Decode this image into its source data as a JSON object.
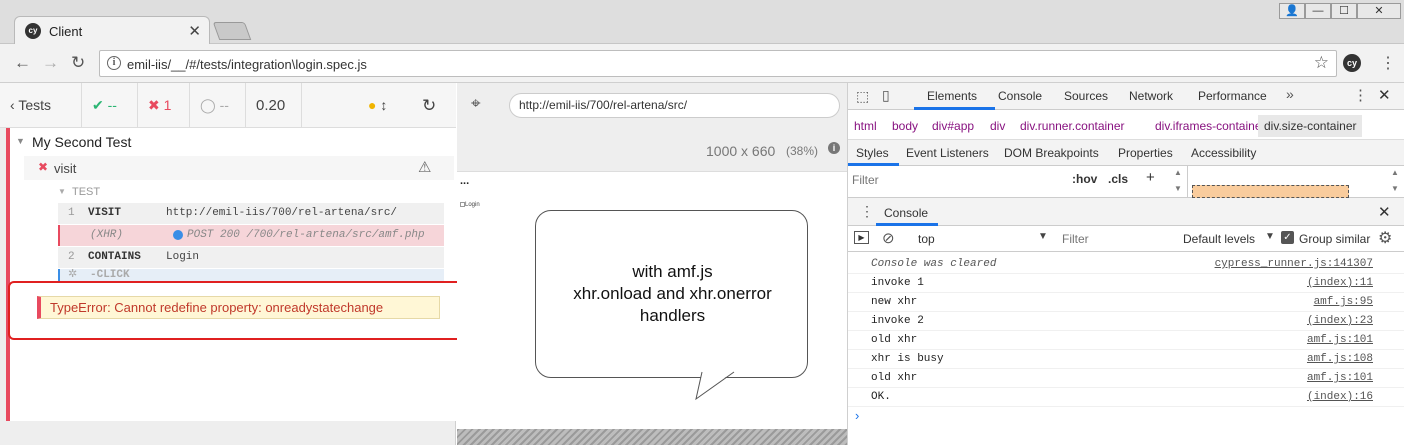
{
  "browser": {
    "tab_title": "Client",
    "url": "emil-iis/__/#/tests/integration\\login.spec.js"
  },
  "reporter": {
    "tests_label": "Tests",
    "passed": "--",
    "failed": "1",
    "pending": "--",
    "duration": "0.20",
    "suite": "My Second Test",
    "test": "visit",
    "section": "TEST",
    "commands": [
      {
        "num": "1",
        "name": "VISIT",
        "message": "http://emil-iis/700/rel-artena/src/"
      },
      {
        "num": "",
        "name": "(XHR)",
        "message": "POST 200 /700/rel-artena/src/amf.php"
      },
      {
        "num": "2",
        "name": "CONTAINS",
        "message": "Login"
      },
      {
        "num": "",
        "name": "-CLICK",
        "message": ""
      }
    ],
    "error": "TypeError: Cannot redefine property: onreadystatechange"
  },
  "aut": {
    "url": "http://emil-iis/700/rel-artena/src/",
    "viewport": "1000 x 660",
    "scale": "(38%)",
    "page_ellipsis": "...",
    "page_login": "Login"
  },
  "annotation": {
    "line1": "with amf.js",
    "line2": "xhr.onload and xhr.onerror",
    "line3": "handlers"
  },
  "devtools": {
    "tabs": [
      "Elements",
      "Console",
      "Sources",
      "Network",
      "Performance"
    ],
    "breadcrumbs": [
      "html",
      "body",
      "div#app",
      "div",
      "div.runner.container",
      "div.iframes-container",
      "div.size-container"
    ],
    "subtabs": [
      "Styles",
      "Event Listeners",
      "DOM Breakpoints",
      "Properties",
      "Accessibility"
    ],
    "filter_placeholder": "Filter",
    "hov": ":hov",
    "cls": ".cls",
    "drawer_title": "Console",
    "context": "top",
    "console_filter_placeholder": "Filter",
    "levels": "Default levels",
    "group_similar": "Group similar",
    "logs": [
      {
        "message": "Console was cleared",
        "source": "cypress_runner.js:141307",
        "italic": true
      },
      {
        "message": "invoke 1",
        "source": "(index):11"
      },
      {
        "message": "new xhr",
        "source": "amf.js:95"
      },
      {
        "message": "invoke 2",
        "source": "(index):23"
      },
      {
        "message": "old xhr",
        "source": "amf.js:101"
      },
      {
        "message": "xhr is busy",
        "source": "amf.js:108"
      },
      {
        "message": "old xhr",
        "source": "amf.js:101"
      },
      {
        "message": "OK.",
        "source": "(index):16"
      }
    ]
  },
  "colors": {
    "fail_red": "#e84a5f",
    "pass_green": "#2bb573",
    "devtools_blue": "#1a73e8"
  }
}
